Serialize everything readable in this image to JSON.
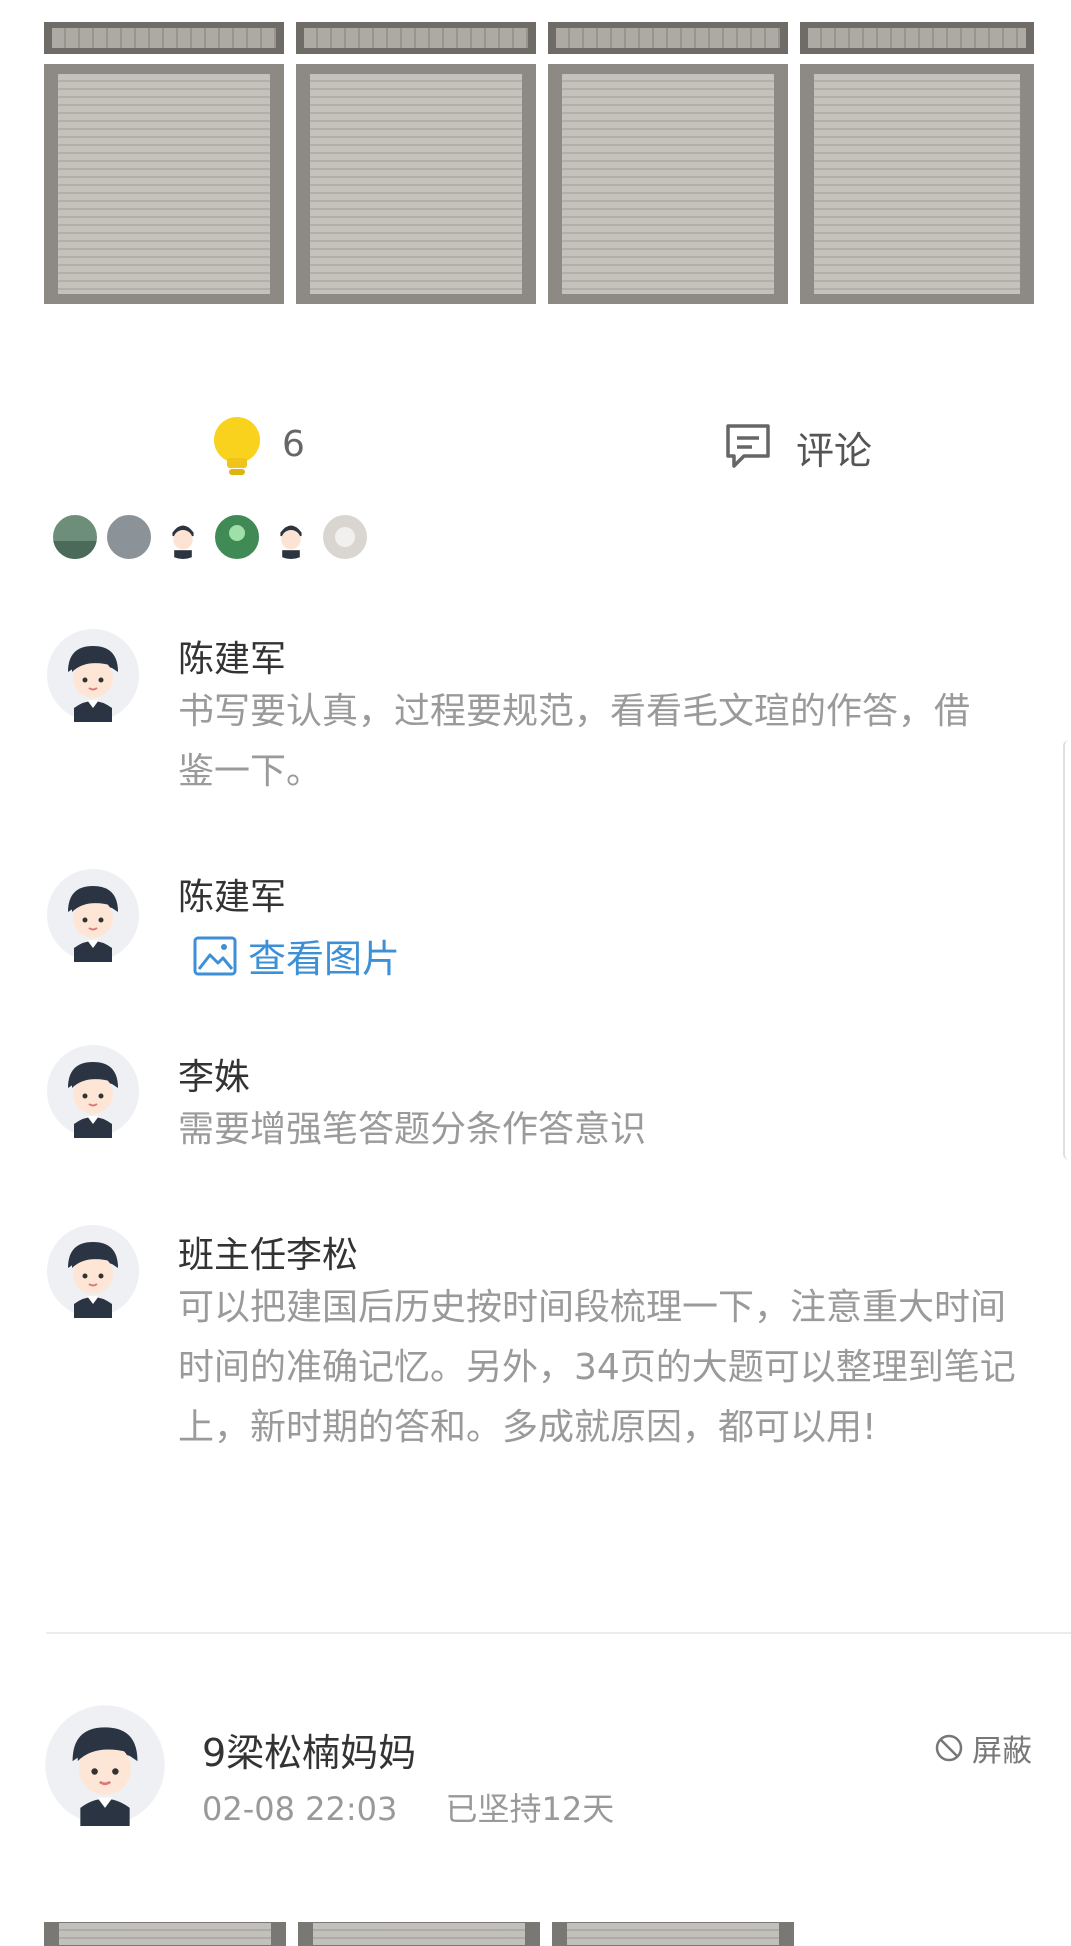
{
  "photos_top": [
    {
      "name": "homework-photo-1"
    },
    {
      "name": "homework-photo-2"
    },
    {
      "name": "homework-photo-3"
    },
    {
      "name": "homework-photo-4"
    }
  ],
  "actions": {
    "like_icon": "lightbulb-icon",
    "like_count": "6",
    "comment_icon": "comment-icon",
    "comment_label": "评论"
  },
  "likers": [
    {
      "name": "liker-avatar-1",
      "color": "#6d8f7a"
    },
    {
      "name": "liker-avatar-2",
      "color": "#8b9298"
    },
    {
      "name": "liker-avatar-3",
      "color": "#ffffff"
    },
    {
      "name": "liker-avatar-4",
      "color": "#3f8a55"
    },
    {
      "name": "liker-avatar-5",
      "color": "#ffffff"
    },
    {
      "name": "liker-avatar-6",
      "color": "#d9d6d2"
    }
  ],
  "comments": [
    {
      "author": "陈建军",
      "text": "书写要认真，过程要规范，看看毛文瑄的作答，借鉴一下。"
    },
    {
      "author": "陈建军",
      "link_label": "查看图片",
      "link_icon": "image-icon"
    },
    {
      "author": "李姝",
      "text": "需要增强笔答题分条作答意识"
    },
    {
      "author": "班主任李松",
      "text": "可以把建国后历史按时间段梳理一下，注意重大时间时间的准确记忆。另外，34页的大题可以整理到笔记上，新时期的答和。多成就原因，都可以用!"
    }
  ],
  "post": {
    "author": "9梁松楠妈妈",
    "datetime": "02-08 22:03",
    "streak": "已坚持12天",
    "block_icon": "block-icon",
    "block_label": "屏蔽"
  },
  "colors": {
    "accent_link": "#3d8fd6",
    "bulb": "#f8d21c",
    "text_muted": "#9a9a9a"
  }
}
